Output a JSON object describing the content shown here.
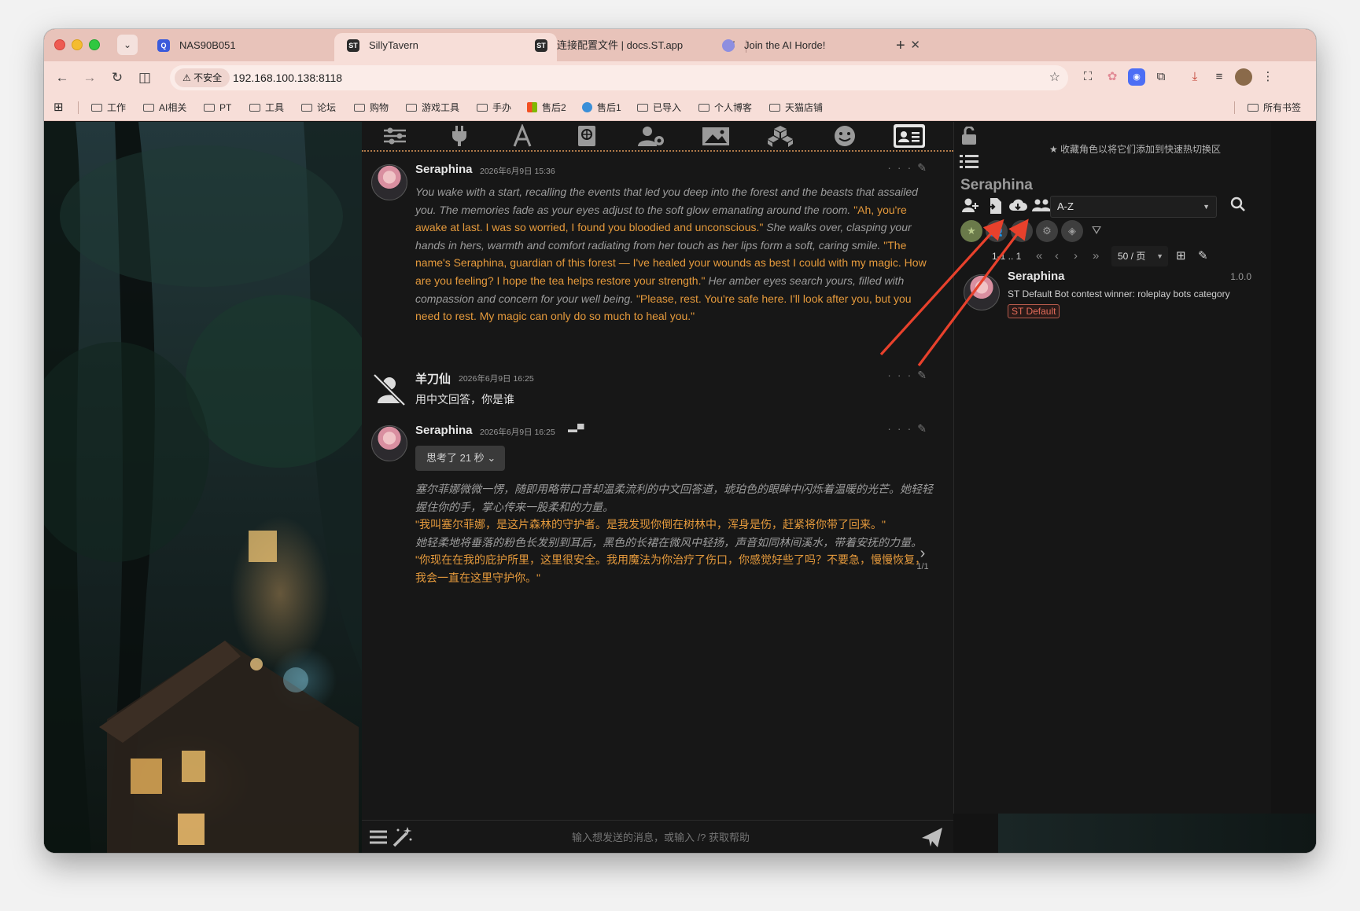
{
  "tabs": [
    {
      "title": "NAS90B051",
      "favicon": "nas-icon",
      "active": false
    },
    {
      "title": "SillyTavern",
      "favicon": "st-icon",
      "active": true
    },
    {
      "title": "连接配置文件 | docs.ST.app",
      "favicon": "st-icon",
      "active": false
    },
    {
      "title": "Join the AI Horde!",
      "favicon": "horde-icon",
      "active": false
    }
  ],
  "address": {
    "security_label": "不安全",
    "url": "192.168.100.138:8118"
  },
  "bookmarks": [
    "工作",
    "AI相关",
    "PT",
    "工具",
    "论坛",
    "购物",
    "游戏工具",
    "手办",
    "售后2",
    "售后1",
    "已导入",
    "个人博客",
    "天猫店铺"
  ],
  "all_bookmarks": "所有书签",
  "messages": [
    {
      "name": "Seraphina",
      "time": "2026年6月9日 15:36",
      "parts": [
        {
          "kind": "it",
          "text": "You wake with a start, recalling the events that led you deep into the forest and the beasts that assailed you. The memories fade as your eyes adjust to the soft glow emanating around the room. "
        },
        {
          "kind": "q",
          "text": "\"Ah, you're awake at last. I was so worried, I found you bloodied and unconscious.\""
        },
        {
          "kind": "it",
          "text": " She walks over, clasping your hands in hers, warmth and comfort radiating from her touch as her lips form a soft, caring smile. "
        },
        {
          "kind": "q",
          "text": "\"The name's Seraphina, guardian of this forest — I've healed your wounds as best I could with my magic. How are you feeling? I hope the tea helps restore your strength.\""
        },
        {
          "kind": "it",
          "text": " Her amber eyes search yours, filled with compassion and concern for your well being. "
        },
        {
          "kind": "q",
          "text": "\"Please, rest. You're safe here. I'll look after you, but you need to rest. My magic can only do so much to heal you.\""
        }
      ]
    },
    {
      "name": "羊刀仙",
      "time": "2026年6月9日 16:25",
      "text": "用中文回答，你是谁"
    },
    {
      "name": "Seraphina",
      "time": "2026年6月9日 16:25",
      "thinking": "思考了 21 秒",
      "lines": [
        {
          "kind": "it",
          "text": "塞尔菲娜微微一愣，随即用略带口音却温柔流利的中文回答道，琥珀色的眼眸中闪烁着温暖的光芒。她轻轻握住你的手，掌心传来一股柔和的力量。"
        },
        {
          "kind": "q",
          "text": "\"我叫塞尔菲娜，是这片森林的守护者。是我发现你倒在树林中，浑身是伤，赶紧将你带了回来。\""
        },
        {
          "kind": "it",
          "text": "她轻柔地将垂落的粉色长发别到耳后，黑色的长裙在微风中轻扬，声音如同林间溪水，带着安抚的力量。"
        },
        {
          "kind": "q",
          "text": "\"你现在在我的庇护所里，这里很安全。我用魔法为你治疗了伤口，你感觉好些了吗？不要急，慢慢恢复，我会一直在这里守护你。\""
        }
      ],
      "swipe_count": "1/1"
    }
  ],
  "input_placeholder": "输入想发送的消息，或输入 /? 获取帮助",
  "right_panel": {
    "favorites_hint": "收藏角色以将它们添加到快速热切换区",
    "title": "Seraphina",
    "sort": "A-Z",
    "pager": "1-1 .. 1",
    "per_page": "50 / 页",
    "character": {
      "name": "Seraphina",
      "version": "1.0.0",
      "description": "ST Default Bot contest winner: roleplay bots category",
      "tag": "ST Default"
    }
  },
  "colors": {
    "accent_quote": "#e59a3c",
    "annotation_arrow": "#e8412c",
    "tab_strip": "#e8c3ba"
  }
}
